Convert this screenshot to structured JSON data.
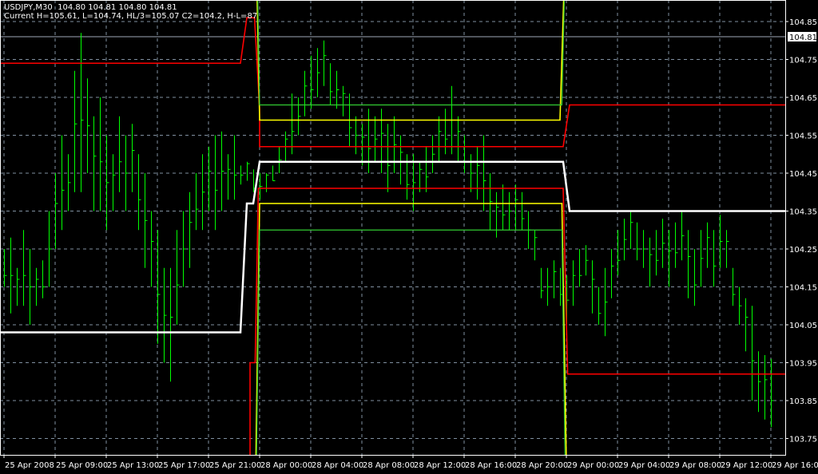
{
  "header": {
    "symbol_line": "USDJPY,M30  104.80 104.81 104.80 104.81",
    "indicator_line": "Current H=105.61, L=104.74, HL/3=105.07 C2=104.2, H-L=87"
  },
  "colors": {
    "background": "#000000",
    "bars": "#00ff00",
    "grid": "#8090a0",
    "axis": "#ffffff",
    "current_price_line": "#a0a8b8"
  },
  "chart_data": {
    "type": "bar",
    "symbol": "USDJPY",
    "timeframe": "M30",
    "current_price": 104.81,
    "current_price_label": "104.81",
    "ylim": [
      103.7,
      104.9
    ],
    "y_ticks": [
      "104.85",
      "104.75",
      "104.65",
      "104.55",
      "104.45",
      "104.35",
      "104.25",
      "104.15",
      "104.05",
      "103.95",
      "103.85",
      "103.75"
    ],
    "x_ticks": [
      {
        "bar": 0,
        "label": "25 Apr 2008"
      },
      {
        "bar": 8,
        "label": "25 Apr 09:00"
      },
      {
        "bar": 16,
        "label": "25 Apr 13:00"
      },
      {
        "bar": 24,
        "label": "25 Apr 17:00"
      },
      {
        "bar": 32,
        "label": "25 Apr 21:00"
      },
      {
        "bar": 40,
        "label": "28 Apr 00:00"
      },
      {
        "bar": 48,
        "label": "28 Apr 04:00"
      },
      {
        "bar": 56,
        "label": "28 Apr 08:00"
      },
      {
        "bar": 64,
        "label": "28 Apr 12:00"
      },
      {
        "bar": 72,
        "label": "28 Apr 16:00"
      },
      {
        "bar": 80,
        "label": "28 Apr 20:00"
      },
      {
        "bar": 88,
        "label": "29 Apr 00:00"
      },
      {
        "bar": 96,
        "label": "29 Apr 04:00"
      },
      {
        "bar": 104,
        "label": "29 Apr 08:00"
      },
      {
        "bar": 112,
        "label": "29 Apr 12:00"
      },
      {
        "bar": 120,
        "label": "29 Apr 16:00"
      }
    ],
    "bars_high_low": [
      [
        104.25,
        104.15
      ],
      [
        104.28,
        104.08
      ],
      [
        104.2,
        104.1
      ],
      [
        104.3,
        104.1
      ],
      [
        104.25,
        104.05
      ],
      [
        104.2,
        104.1
      ],
      [
        104.22,
        104.12
      ],
      [
        104.35,
        104.15
      ],
      [
        104.45,
        104.25
      ],
      [
        104.55,
        104.3
      ],
      [
        104.5,
        104.35
      ],
      [
        104.72,
        104.4
      ],
      [
        104.82,
        104.4
      ],
      [
        104.7,
        104.45
      ],
      [
        104.6,
        104.35
      ],
      [
        104.65,
        104.35
      ],
      [
        104.55,
        104.3
      ],
      [
        104.5,
        104.35
      ],
      [
        104.6,
        104.4
      ],
      [
        104.55,
        104.35
      ],
      [
        104.58,
        104.4
      ],
      [
        104.5,
        104.3
      ],
      [
        104.45,
        104.2
      ],
      [
        104.35,
        104.15
      ],
      [
        104.3,
        104.0
      ],
      [
        104.2,
        103.95
      ],
      [
        104.2,
        103.9
      ],
      [
        104.3,
        104.05
      ],
      [
        104.35,
        104.15
      ],
      [
        104.4,
        104.2
      ],
      [
        104.45,
        104.3
      ],
      [
        104.5,
        104.3
      ],
      [
        104.52,
        104.35
      ],
      [
        104.55,
        104.3
      ],
      [
        104.56,
        104.35
      ],
      [
        104.5,
        104.38
      ],
      [
        104.55,
        104.38
      ],
      [
        104.47,
        104.42
      ],
      [
        104.48,
        104.43
      ],
      [
        104.46,
        104.4
      ],
      [
        104.45,
        104.38
      ],
      [
        104.45,
        104.4
      ],
      [
        104.47,
        104.43
      ],
      [
        104.52,
        104.45
      ],
      [
        104.56,
        104.48
      ],
      [
        104.66,
        104.5
      ],
      [
        104.65,
        104.55
      ],
      [
        104.72,
        104.6
      ],
      [
        104.76,
        104.62
      ],
      [
        104.78,
        104.65
      ],
      [
        104.8,
        104.68
      ],
      [
        104.74,
        104.63
      ],
      [
        104.72,
        104.62
      ],
      [
        104.68,
        104.6
      ],
      [
        104.66,
        104.52
      ],
      [
        104.6,
        104.5
      ],
      [
        104.58,
        104.47
      ],
      [
        104.62,
        104.45
      ],
      [
        104.6,
        104.48
      ],
      [
        104.62,
        104.45
      ],
      [
        104.58,
        104.4
      ],
      [
        104.6,
        104.45
      ],
      [
        104.55,
        104.42
      ],
      [
        104.5,
        104.38
      ],
      [
        104.5,
        104.35
      ],
      [
        104.48,
        104.4
      ],
      [
        104.52,
        104.4
      ],
      [
        104.55,
        104.45
      ],
      [
        104.6,
        104.48
      ],
      [
        104.62,
        104.5
      ],
      [
        104.68,
        104.5
      ],
      [
        104.6,
        104.48
      ],
      [
        104.55,
        104.45
      ],
      [
        104.5,
        104.4
      ],
      [
        104.52,
        104.38
      ],
      [
        104.55,
        104.35
      ],
      [
        104.45,
        104.3
      ],
      [
        104.4,
        104.28
      ],
      [
        104.42,
        104.3
      ],
      [
        104.4,
        104.3
      ],
      [
        104.42,
        104.3
      ],
      [
        104.4,
        104.3
      ],
      [
        104.35,
        104.25
      ],
      [
        104.3,
        104.22
      ],
      [
        104.2,
        104.12
      ],
      [
        104.2,
        104.1
      ],
      [
        104.22,
        104.12
      ],
      [
        104.2,
        104.1
      ],
      [
        104.18,
        104.05
      ],
      [
        104.22,
        104.1
      ],
      [
        104.25,
        104.15
      ],
      [
        104.26,
        104.18
      ],
      [
        104.22,
        104.08
      ],
      [
        104.15,
        104.05
      ],
      [
        104.2,
        104.02
      ],
      [
        104.25,
        104.12
      ],
      [
        104.3,
        104.18
      ],
      [
        104.33,
        104.22
      ],
      [
        104.35,
        104.25
      ],
      [
        104.32,
        104.22
      ],
      [
        104.3,
        104.2
      ],
      [
        104.28,
        104.15
      ],
      [
        104.3,
        104.18
      ],
      [
        104.33,
        104.2
      ],
      [
        104.3,
        104.15
      ],
      [
        104.32,
        104.2
      ],
      [
        104.35,
        104.22
      ],
      [
        104.3,
        104.12
      ],
      [
        104.25,
        104.1
      ],
      [
        104.3,
        104.15
      ],
      [
        104.32,
        104.2
      ],
      [
        104.3,
        104.15
      ],
      [
        104.34,
        104.2
      ],
      [
        104.3,
        104.2
      ],
      [
        104.2,
        104.1
      ],
      [
        104.15,
        104.05
      ],
      [
        104.12,
        103.98
      ],
      [
        104.1,
        103.85
      ],
      [
        103.98,
        103.82
      ],
      [
        103.97,
        103.8
      ],
      [
        103.96,
        103.78
      ]
    ],
    "indicator_lines": [
      {
        "name": "pivot",
        "color": "#ffffff",
        "width": 2.5,
        "points": [
          [
            -1,
            104.03
          ],
          [
            37,
            104.03
          ],
          [
            38,
            104.37
          ],
          [
            39,
            104.37
          ],
          [
            40,
            104.48
          ],
          [
            87.5,
            104.48
          ],
          [
            88.5,
            104.35
          ],
          [
            123,
            104.35
          ]
        ]
      },
      {
        "name": "resistance",
        "color": "#ff0000",
        "width": 1.6,
        "points": [
          [
            -1,
            104.74
          ],
          [
            37,
            104.74
          ],
          [
            38,
            104.86
          ],
          [
            39.2,
            104.86
          ],
          [
            40,
            104.62
          ],
          [
            40,
            104.52
          ],
          [
            87.5,
            104.52
          ],
          [
            88.5,
            104.63
          ],
          [
            123,
            104.63
          ]
        ]
      },
      {
        "name": "support",
        "color": "#ff0000",
        "width": 1.6,
        "points": [
          [
            38.5,
            103.68
          ],
          [
            38.5,
            103.95
          ],
          [
            39.3,
            103.95
          ],
          [
            39.8,
            104.41
          ],
          [
            87.5,
            104.41
          ],
          [
            88.2,
            103.92
          ],
          [
            123,
            103.92
          ]
        ]
      },
      {
        "name": "yellow-upper",
        "color": "#ffff00",
        "width": 1.6,
        "points": [
          [
            39.6,
            104.92
          ],
          [
            40,
            104.59
          ],
          [
            87,
            104.59
          ],
          [
            87.6,
            104.92
          ]
        ]
      },
      {
        "name": "yellow-lower",
        "color": "#ffff00",
        "width": 1.6,
        "points": [
          [
            39.4,
            103.68
          ],
          [
            40,
            104.37
          ],
          [
            87.3,
            104.37
          ],
          [
            88,
            103.68
          ]
        ]
      },
      {
        "name": "green-upper",
        "color": "#33cc33",
        "width": 1.2,
        "points": [
          [
            39.7,
            104.92
          ],
          [
            40,
            104.63
          ],
          [
            87.3,
            104.63
          ],
          [
            87.7,
            104.92
          ]
        ]
      },
      {
        "name": "green-lower",
        "color": "#33cc33",
        "width": 1.2,
        "points": [
          [
            39.5,
            103.68
          ],
          [
            40,
            104.3
          ],
          [
            87.3,
            104.3
          ],
          [
            87.8,
            103.68
          ]
        ]
      }
    ]
  }
}
